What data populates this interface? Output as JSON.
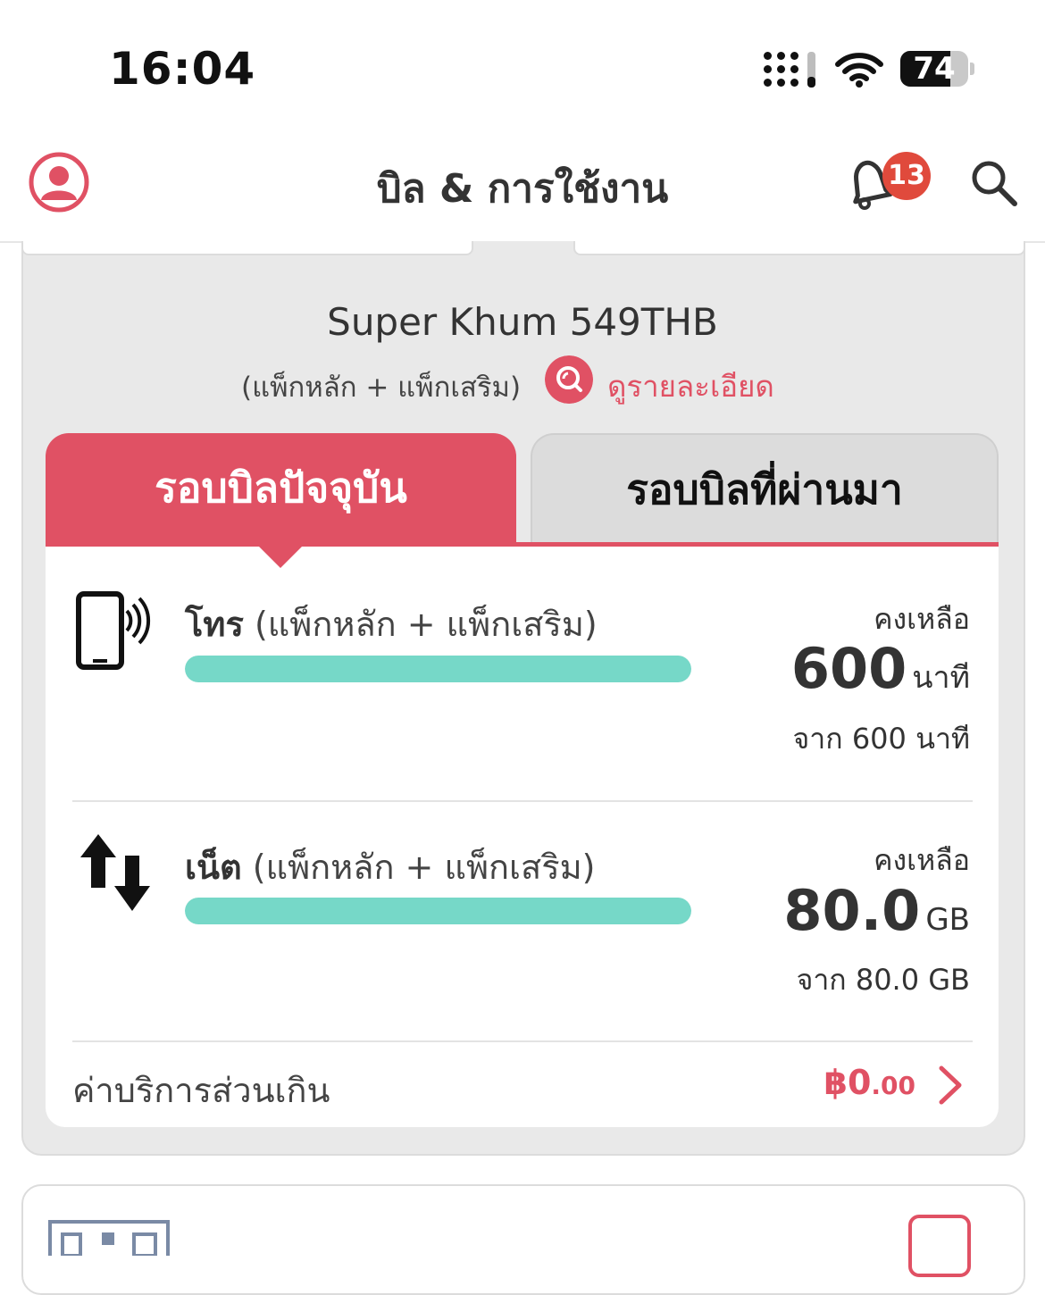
{
  "status_bar": {
    "time": "16:04",
    "battery": "74",
    "battery_level": 0.74
  },
  "header": {
    "title": "บิล & การใช้งาน",
    "notification_count": "13"
  },
  "package": {
    "name": "Super Khum 549THB",
    "subtitle": "(แพ็กหลัก +  แพ็กเสริม)",
    "detail_link": "ดูรายละเอียด"
  },
  "tabs": [
    {
      "label": "รอบบิลปัจจุบัน",
      "active": true
    },
    {
      "label": "รอบบิลที่ผ่านมา",
      "active": false
    }
  ],
  "usage": [
    {
      "icon": "phone-call-icon",
      "title": "โทร",
      "subtitle": "(แพ็กหลัก + แพ็กเสริม)",
      "remaining_label": "คงเหลือ",
      "remaining_value": "600",
      "remaining_unit": "นาที",
      "from_text": "จาก 600 นาที",
      "progress": 1.0
    },
    {
      "icon": "data-transfer-icon",
      "title": "เน็ต",
      "subtitle": "(แพ็กหลัก + แพ็กเสริม)",
      "remaining_label": "คงเหลือ",
      "remaining_value": "80.0",
      "remaining_unit": "GB",
      "from_text": "จาก 80.0 GB",
      "progress": 1.0
    }
  ],
  "overage": {
    "label": "ค่าบริการส่วนเกิน",
    "currency": "฿",
    "amount": "0",
    "cents": ".00"
  },
  "colors": {
    "accent": "#e05164",
    "progress": "#76d8c8",
    "badge": "#e04a3c"
  }
}
